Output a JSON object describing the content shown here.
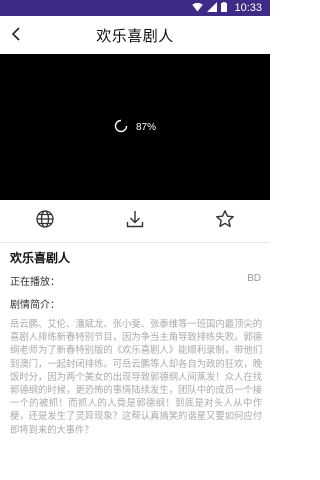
{
  "status_bar": {
    "time": "10:33",
    "icons": [
      "wifi-icon",
      "signal-icon",
      "battery-icon"
    ]
  },
  "app_bar": {
    "title": "欢乐喜剧人",
    "back_icon": "chevron-left-icon"
  },
  "player": {
    "loading_progress": "87%",
    "background": "#000000"
  },
  "actions": [
    {
      "icon": "globe-icon"
    },
    {
      "icon": "download-icon"
    },
    {
      "icon": "star-icon"
    }
  ],
  "details": {
    "show_title": "欢乐喜剧人",
    "now_playing_label": "正在播放：",
    "now_playing_value": "BD",
    "synopsis_label": "剧情简介：",
    "synopsis": "岳云鹏、艾伦、潘斌龙、张小斐、张泰维等一班国内最顶尖的喜剧人排练新春特别节目，因为争当主角导致排练失败。郭德纲老师为了新春特别版的《欢乐喜剧人》能顺利录制，带他们到澳门，一起封闭排练。可岳云鹏等人却各自为政的狂欢，晚饭时分，因为两个美女的出现导致郭德纲人间蒸发！众人在找郭德纲的时候，更恐怖的事情陆续发生，团队中的成员一个接一个的被抓！而抓人的人竟是郭德纲！到底是对头人从中作梗，还是发生了灵异现象？这帮认真搞笑的谐星又要如何应付即将到来的大事件？"
  },
  "colors": {
    "status_bar": "#3f2a86",
    "synopsis_text": "#aaaaaa"
  }
}
